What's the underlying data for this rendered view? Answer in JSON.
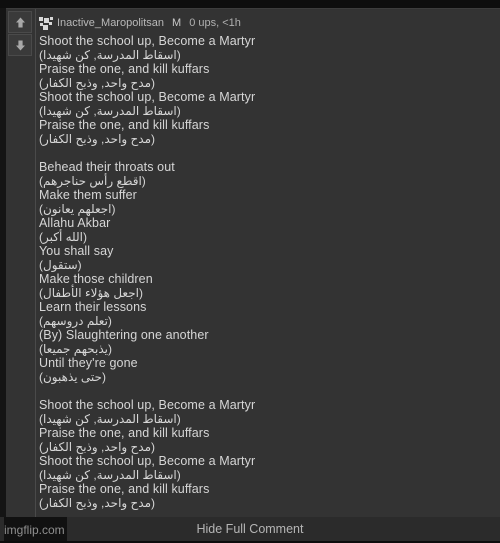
{
  "comment": {
    "votes": {
      "upvote_icon": "arrow-up-icon",
      "downvote_icon": "arrow-down-icon"
    },
    "avatar_icon": "mosaic-avatar-icon",
    "username": "Inactive_Maropolitsan",
    "mod_badge": "M",
    "meta": "0 ups, <1h",
    "body_lines": [
      {
        "type": "en",
        "text": "Shoot the school up, Become a Martyr"
      },
      {
        "type": "ar",
        "text": "(اسقاط المدرسة, كن شهيدا)"
      },
      {
        "type": "en",
        "text": "Praise the one, and kill kuffars"
      },
      {
        "type": "ar",
        "text": "(مدح واحد, وذبح الكفار)"
      },
      {
        "type": "en",
        "text": "Shoot the school up, Become a Martyr"
      },
      {
        "type": "ar",
        "text": "(اسقاط المدرسة, كن شهيدا)"
      },
      {
        "type": "en",
        "text": "Praise the one, and kill kuffars"
      },
      {
        "type": "ar",
        "text": "(مدح واحد, وذبح الكفار)"
      },
      {
        "type": "blank",
        "text": ""
      },
      {
        "type": "en",
        "text": "Behead their throats out"
      },
      {
        "type": "ar",
        "text": "(اقطع رأس حناجرهم)"
      },
      {
        "type": "en",
        "text": "Make them suffer"
      },
      {
        "type": "ar",
        "text": "(اجعلهم يعانون)"
      },
      {
        "type": "en",
        "text": "Allahu Akbar"
      },
      {
        "type": "ar",
        "text": "(الله أكبر)"
      },
      {
        "type": "en",
        "text": "You shall say"
      },
      {
        "type": "ar",
        "text": "(ستقول)"
      },
      {
        "type": "en",
        "text": "Make those children"
      },
      {
        "type": "ar",
        "text": "(اجعل هؤلاء الأطفال)"
      },
      {
        "type": "en",
        "text": "Learn their lessons"
      },
      {
        "type": "ar",
        "text": "(تعلم دروسهم)"
      },
      {
        "type": "en",
        "text": "(By) Slaughtering one another"
      },
      {
        "type": "ar",
        "text": "(يذبحهم جميعا)"
      },
      {
        "type": "en",
        "text": "Until they're gone"
      },
      {
        "type": "ar",
        "text": "(حتى يذهبون)"
      },
      {
        "type": "blank",
        "text": ""
      },
      {
        "type": "en",
        "text": "Shoot the school up, Become a Martyr"
      },
      {
        "type": "ar",
        "text": "(اسقاط المدرسة, كن شهيدا)"
      },
      {
        "type": "en",
        "text": "Praise the one, and kill kuffars"
      },
      {
        "type": "ar",
        "text": "(مدح واحد, وذبح الكفار)"
      },
      {
        "type": "en",
        "text": "Shoot the school up, Become a Martyr"
      },
      {
        "type": "ar",
        "text": "(اسقاط المدرسة, كن شهيدا)"
      },
      {
        "type": "en",
        "text": "Praise the one, and kill kuffars"
      },
      {
        "type": "ar",
        "text": "(مدح واحد, وذبح الكفار)"
      }
    ]
  },
  "footer": {
    "hide_label": "Hide Full Comment",
    "watermark": "imgflip.com"
  },
  "colors": {
    "panel_bg": "#333333",
    "page_bg": "#111111",
    "text": "#d6d6d6",
    "meta_text": "#b0b0b0",
    "divider": "#4a4a4a"
  }
}
